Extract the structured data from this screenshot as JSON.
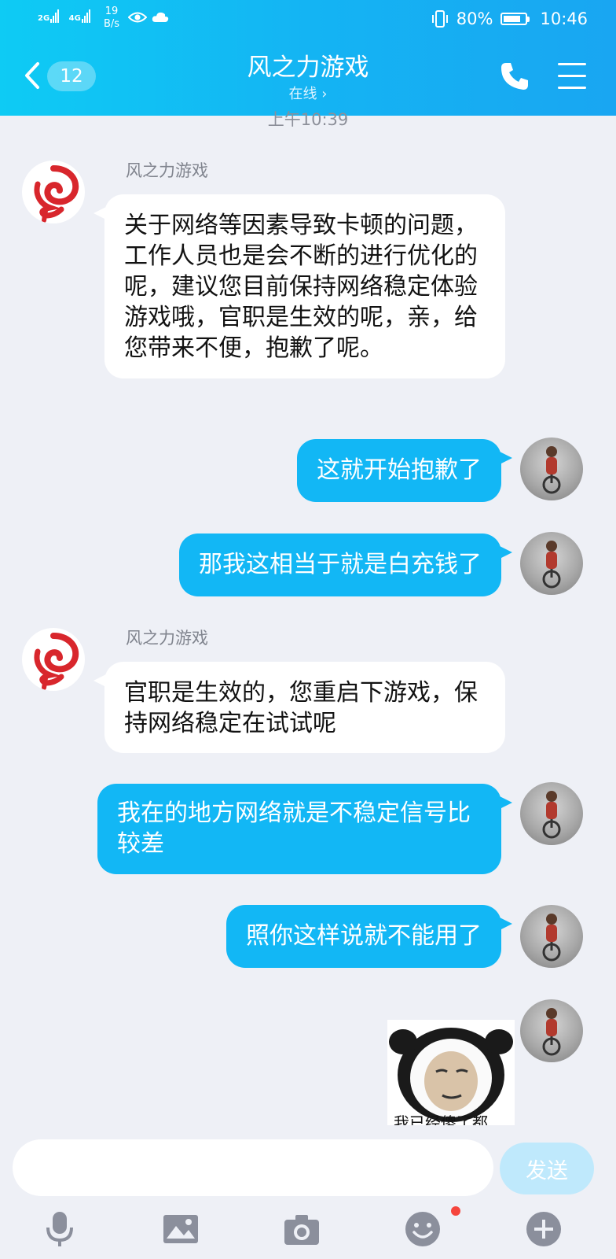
{
  "status_bar": {
    "network_1": "2G",
    "network_2": "4G",
    "speed_value": "19",
    "speed_unit": "B/s",
    "battery": "80%",
    "battery_level": 0.8,
    "time": "10:46"
  },
  "header": {
    "unread_count": "12",
    "title": "风之力游戏",
    "status": "在线",
    "status_chevron": "›"
  },
  "chat": {
    "timestamp": "上午10:39",
    "messages": [
      {
        "from": "风之力游戏",
        "direction": "incoming",
        "text": "关于网络等因素导致卡顿的问题，工作人员也是会不断的进行优化的呢，建议您目前保持网络稳定体验游戏哦，官职是生效的呢，亲，给您带来不便，抱歉了呢。"
      },
      {
        "direction": "outgoing",
        "text": "这就开始抱歉了"
      },
      {
        "direction": "outgoing",
        "text": "那我这相当于就是白充钱了"
      },
      {
        "from": "风之力游戏",
        "direction": "incoming",
        "text": "官职是生效的，您重启下游戏，保持网络稳定在试试呢"
      },
      {
        "direction": "outgoing",
        "text": "我在的地方网络就是不稳定信号比较差"
      },
      {
        "direction": "outgoing",
        "text": "照你这样说就不能用了"
      },
      {
        "direction": "outgoing",
        "type": "sticker",
        "text": "我已经傻了都"
      }
    ]
  },
  "input": {
    "value": "",
    "send_label": "发送"
  },
  "toolbar": [
    "microphone-icon",
    "image-icon",
    "camera-icon",
    "emoji-icon",
    "plus-icon"
  ],
  "colors": {
    "header_start": "#0ecbf4",
    "header_end": "#19a6f2",
    "outgoing_bubble": "#12b7f5",
    "incoming_bubble": "#ffffff",
    "background": "#eef0f6",
    "send_button": "#bfe9fc",
    "notification_dot": "#f5453d"
  }
}
